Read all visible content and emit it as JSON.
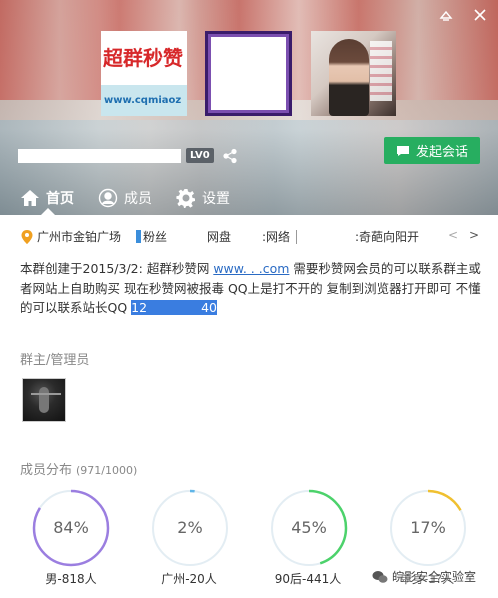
{
  "header": {
    "level_badge": "LV0",
    "chat_button_label": "发起会话",
    "photo1_title": "超群秒赞",
    "photo1_url": "www.cqmiaoz"
  },
  "tabs": [
    {
      "label": "首页",
      "icon": "home-icon",
      "active": true
    },
    {
      "label": "成员",
      "icon": "members-icon",
      "active": false
    },
    {
      "label": "设置",
      "icon": "gear-icon",
      "active": false
    }
  ],
  "info": {
    "location": "广州市金铂广场",
    "fans": "粉丝",
    "net1": "网盘",
    "net2": ":网络",
    "strange": ":奇葩向阳开",
    "nav_prev": "<",
    "nav_next": ">"
  },
  "description": {
    "part1": "本群创建于2015/3/2: 超群秒赞网 ",
    "link": "www.  .        .com",
    "part2": " 需要秒赞网会员的可以联系群主或者网站上自助购买  现在秒赞网被报毒  QQ上是打不开的 复制到浏览器打开即可  不懂的可以联系站长QQ ",
    "qq_start": "12",
    "qq_end": "40"
  },
  "admins": {
    "title": "群主/管理员"
  },
  "distribution": {
    "title": "成员分布",
    "count": "(971/1000)",
    "items": [
      {
        "percent": "84%",
        "value": 0.84,
        "label": "男-818人",
        "color": "#9b7ee0"
      },
      {
        "percent": "2%",
        "value": 0.02,
        "label": "广州-20人",
        "color": "#5fb5e8"
      },
      {
        "percent": "45%",
        "value": 0.45,
        "label": "90后-441人",
        "color": "#4cd26b"
      },
      {
        "percent": "17%",
        "value": 0.17,
        "label": "单身-1?人",
        "color": "#f0c030"
      }
    ]
  },
  "watermark": "皖影安全实验室"
}
